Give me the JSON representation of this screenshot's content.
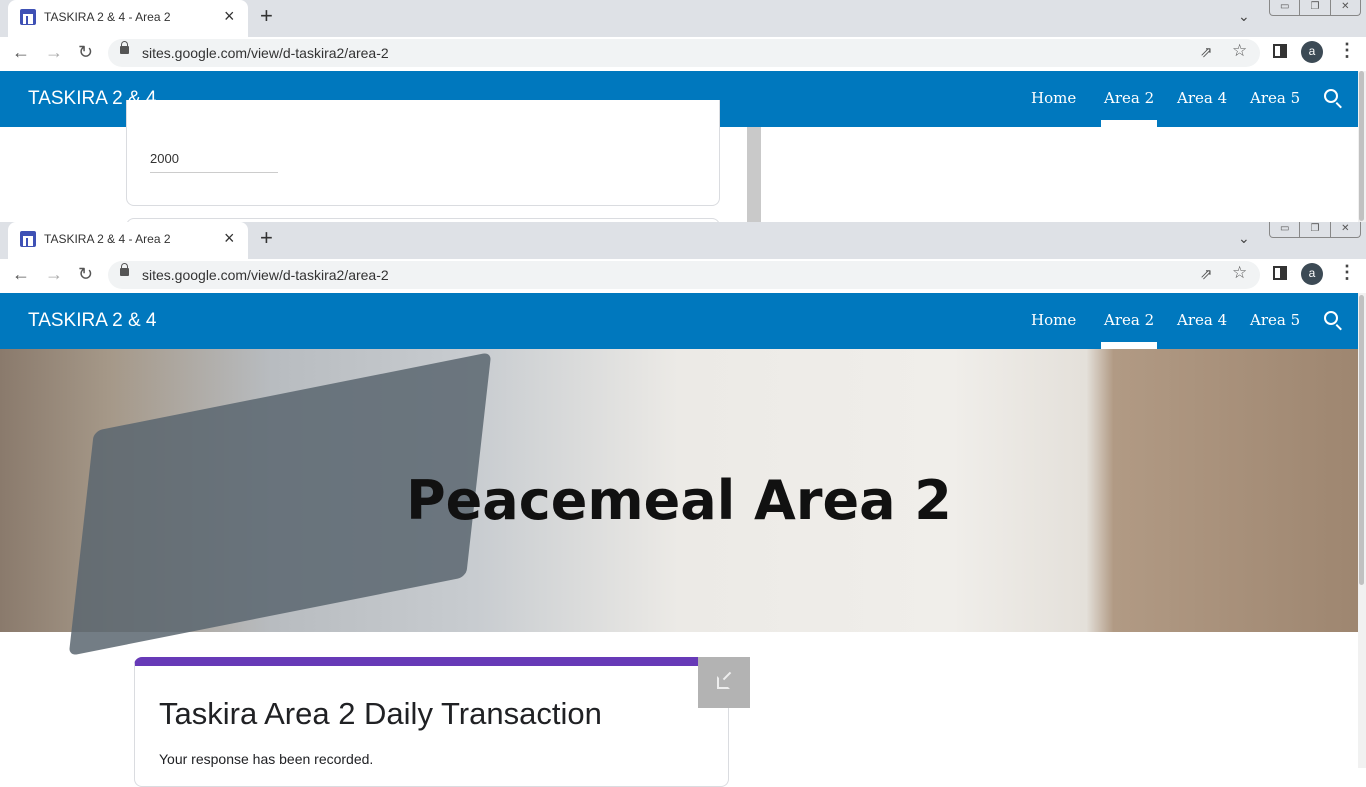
{
  "browser": {
    "tab_title": "TASKIRA 2 & 4 - Area 2",
    "url": "sites.google.com/view/d-taskira2/area-2",
    "avatar_letter": "a"
  },
  "site": {
    "brand": "TASKIRA 2 & 4",
    "nav": [
      "Home",
      "Area 2",
      "Area 4",
      "Area 5"
    ],
    "active_nav": "Area 2",
    "header_color": "#0078be"
  },
  "window1": {
    "input_value": "2000"
  },
  "window2": {
    "hero_title": "Peacemeal Area 2",
    "form_title": "Taskira Area 2 Daily Transaction",
    "form_message": "Your response has been recorded.",
    "form_accent": "#673ab7"
  }
}
